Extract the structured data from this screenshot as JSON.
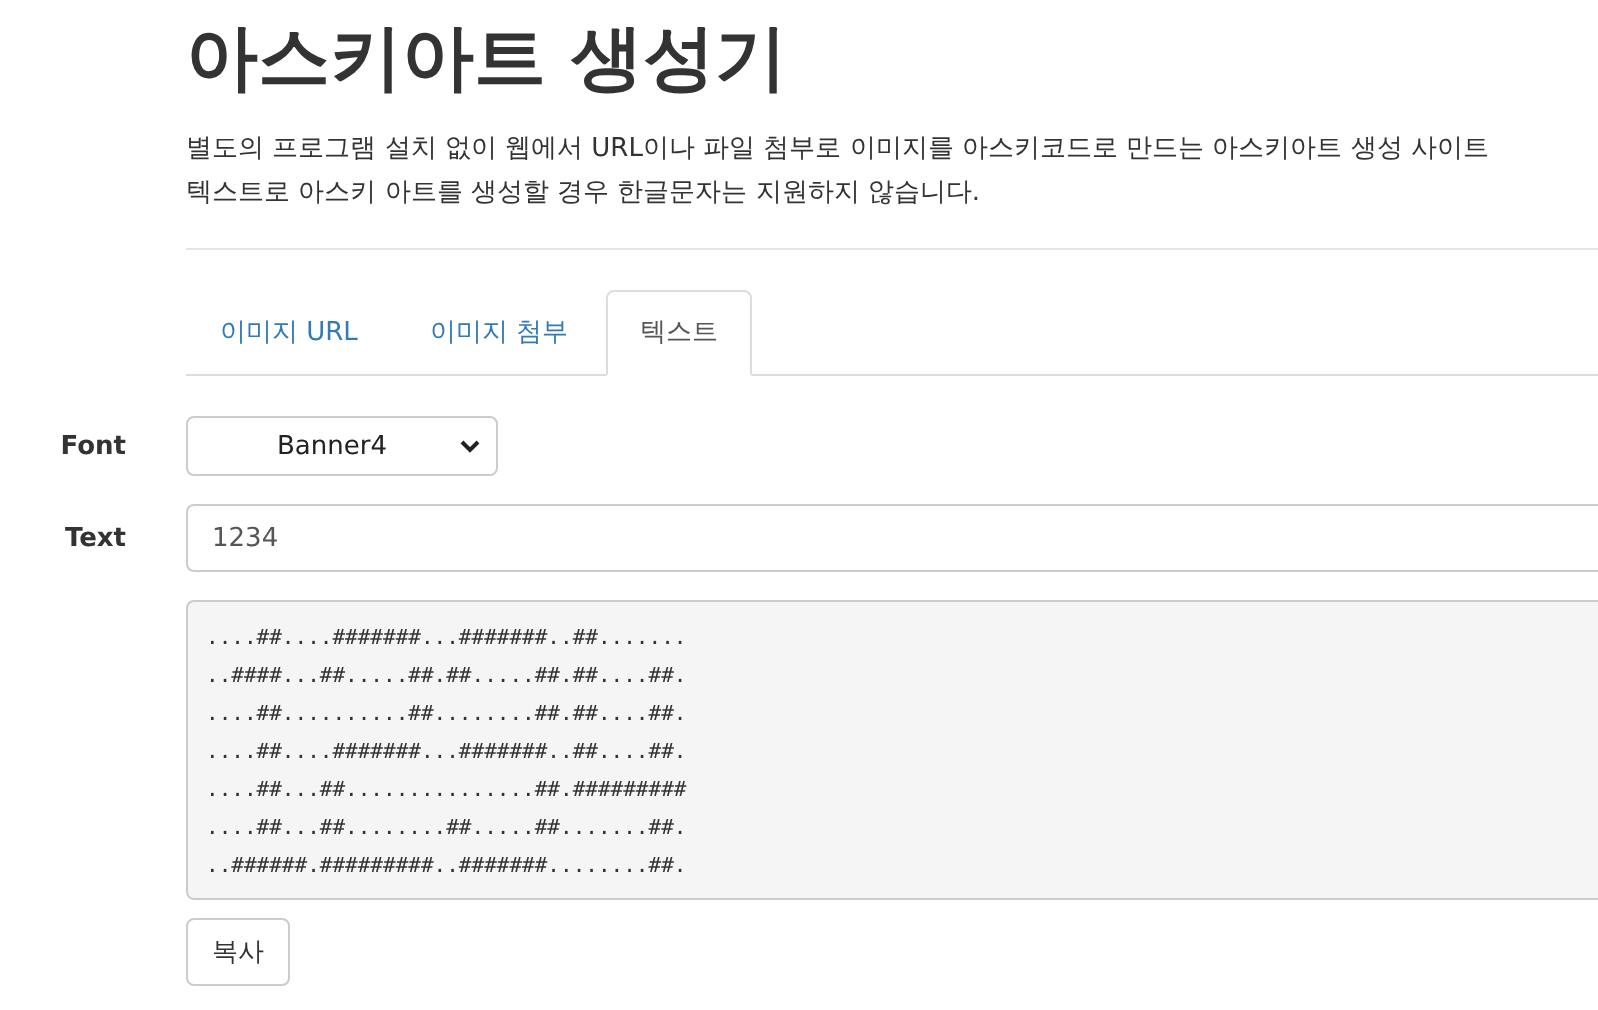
{
  "title": "아스키아트 생성기",
  "description": [
    "별도의 프로그램 설치 없이 웹에서 URL이나 파일 첨부로 이미지를 아스키코드로 만드는 아스키아트 생성 사이트",
    "텍스트로 아스키 아트를 생성할 경우 한글문자는 지원하지 않습니다."
  ],
  "tabs": [
    {
      "label": "이미지 URL",
      "selected": false
    },
    {
      "label": "이미지 첨부",
      "selected": false
    },
    {
      "label": "텍스트",
      "selected": true
    }
  ],
  "font_field": {
    "label": "Font",
    "value": "Banner4"
  },
  "text_field": {
    "label": "Text",
    "value": "1234"
  },
  "ascii_output": [
    "....##....#######...#######..##.......",
    "..####...##.....##.##.....##.##....##.",
    "....##..........##........##.##....##.",
    "....##....#######...#######..##....##.",
    "....##...##...............##.#########",
    "....##...##........##.....##.......##.",
    "..######.#########..#######........##."
  ],
  "copy_button": "복사"
}
